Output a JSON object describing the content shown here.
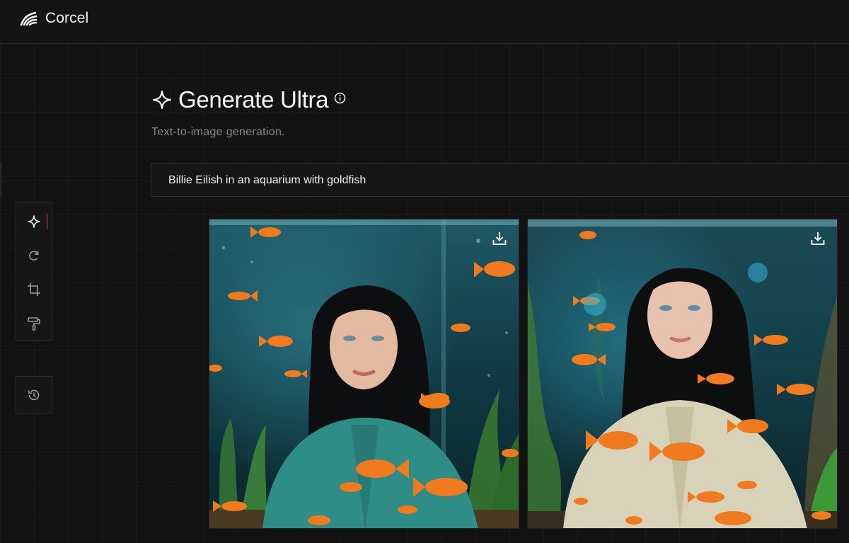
{
  "app": {
    "name": "Corcel"
  },
  "page": {
    "title": "Generate Ultra",
    "subtitle": "Text-to-image generation."
  },
  "prompt": {
    "value": "Billie Eilish in an aquarium with goldfish"
  },
  "toolbar": {
    "tools": [
      {
        "icon": "sparkle-icon",
        "active": true
      },
      {
        "icon": "refresh-icon",
        "active": false
      },
      {
        "icon": "crop-icon",
        "active": false
      },
      {
        "icon": "paint-roller-icon",
        "active": false
      }
    ],
    "history_icon": "history-icon"
  },
  "results": [
    {
      "icon": "download-icon",
      "jacket_color": "#2f8d88"
    },
    {
      "icon": "download-icon",
      "jacket_color": "#d8d3b8"
    }
  ],
  "colors": {
    "background": "#121212",
    "border": "#2e2e2e",
    "text": "#f2f2f2",
    "muted": "#8a8a8a",
    "active_indicator": "#e04848",
    "goldfish": "#f07a1e",
    "water": "#0d2a31"
  }
}
